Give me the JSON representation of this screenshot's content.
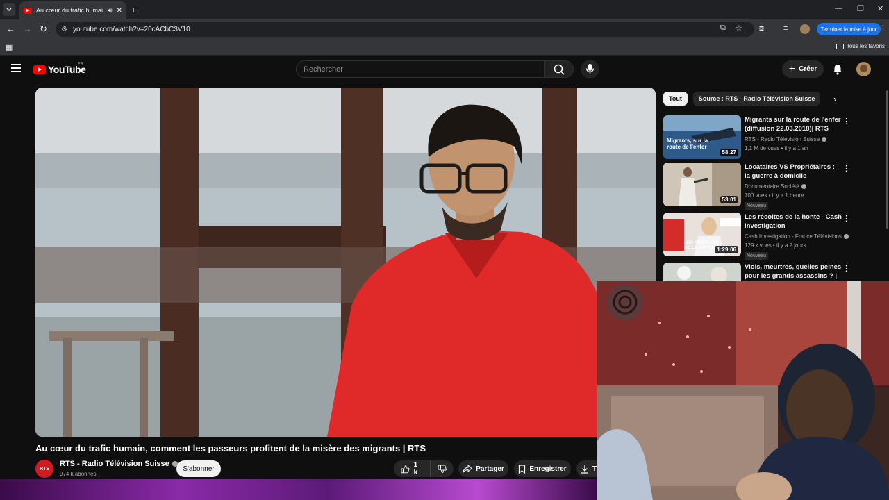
{
  "browser": {
    "tab_title": "Au cœur du trafic humain, c",
    "url": "youtube.com/watch?v=20cACbC3V10",
    "update_label": "Terminer la mise à jour",
    "all_bookmarks_label": "Tous les favoris"
  },
  "header": {
    "logo_text": "YouTube",
    "country_code": "FR",
    "search_placeholder": "Rechercher",
    "create_label": "Créer"
  },
  "video": {
    "title": "Au cœur du trafic humain, comment les passeurs profitent de la misère des migrants | RTS",
    "channel_name": "RTS - Radio Télévision Suisse",
    "channel_avatar_text": "RTS",
    "subscribers": "974 k abonnés",
    "subscribe_label": "S'abonner",
    "like_count": "1 k",
    "share_label": "Partager",
    "save_label": "Enregistrer",
    "download_label": "Té"
  },
  "sidebar": {
    "chips": [
      "Tout",
      "Source : RTS - Radio Télévision Suisse"
    ],
    "recommendations": [
      {
        "title": "Migrants sur la route de l'enfer (diffusion 22.03.2018)| RTS",
        "channel": "RTS - Radio Télévision Suisse",
        "meta": "1,1 M de vues • il y a 1 an",
        "duration": "58:27",
        "thumb_text": "Migrants, sur la route de l'enfer",
        "badge": ""
      },
      {
        "title": "Locataires VS Propriétaires : la guerre à domicile",
        "channel": "Documentaire Société",
        "meta": "700 vues • il y a 1 heure",
        "duration": "53:01",
        "thumb_text": "",
        "badge": "Nouveau"
      },
      {
        "title": "Les récoltes de la honte - Cash investigation",
        "channel": "Cash Investigation - France Télévisions",
        "meta": "129 k vues • il y a 2 jours",
        "duration": "1:29:06",
        "thumb_text": "LES RÉCOLTES DE LA HONTE",
        "badge": "Nouveau"
      },
      {
        "title": "Viols, meurtres, quelles peines pour les grands assassins ? | ...",
        "channel": "",
        "meta": "",
        "duration": "",
        "thumb_text": "",
        "badge": ""
      }
    ]
  }
}
